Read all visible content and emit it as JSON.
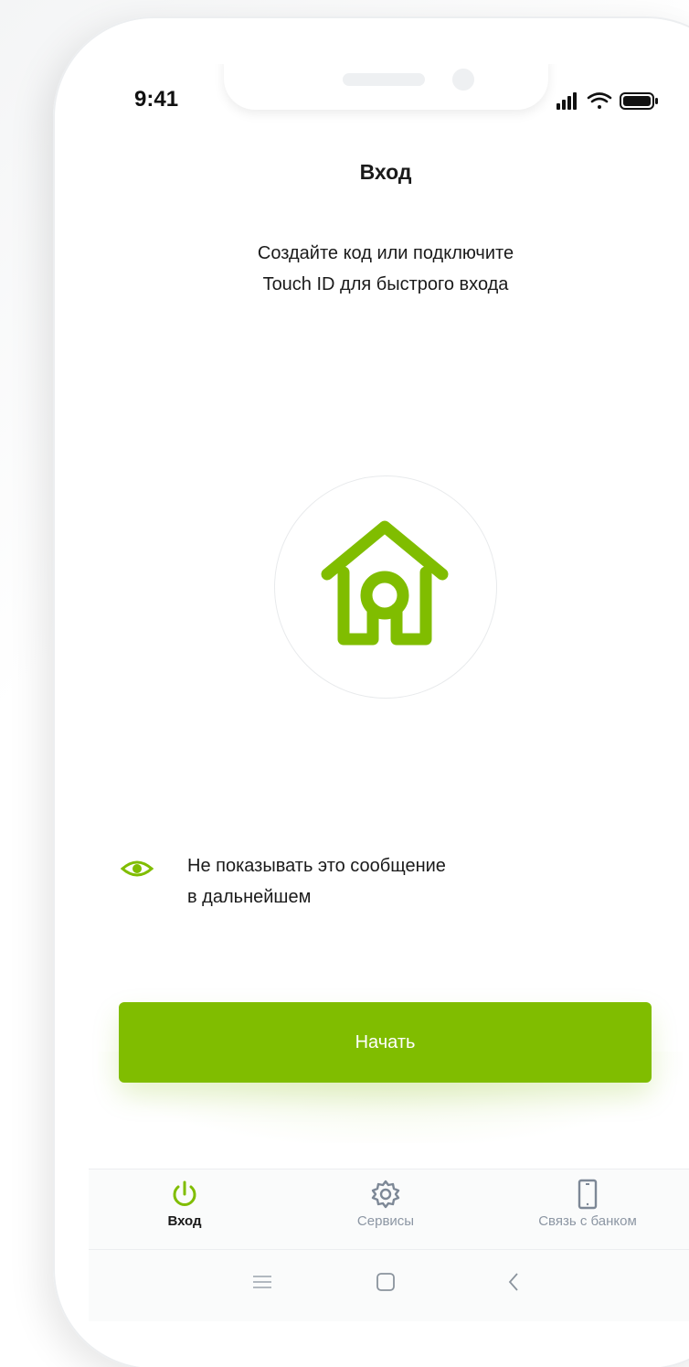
{
  "status_bar": {
    "time": "9:41",
    "icons": [
      "signal-icon",
      "wifi-icon",
      "battery-icon"
    ]
  },
  "header": {
    "title": "Вход"
  },
  "intro": {
    "line1": "Создайте код или подключите",
    "line2": "Touch ID для быстрого входа"
  },
  "logo": {
    "icon": "house-key-logo-icon",
    "color": "#80bd00"
  },
  "option": {
    "icon": "eye-icon",
    "line1": "Не показывать это сообщение",
    "line2": "в дальнейшем"
  },
  "primary_button": {
    "label": "Начать",
    "color": "#80bd00"
  },
  "tabbar": {
    "items": [
      {
        "label": "Вход",
        "icon": "power-icon",
        "active": true
      },
      {
        "label": "Сервисы",
        "icon": "gear-icon",
        "active": false
      },
      {
        "label": "Связь с банком",
        "icon": "phone-icon",
        "active": false
      }
    ]
  },
  "system_nav": {
    "icons": [
      "menu-icon",
      "home-square-icon",
      "back-chevron-icon"
    ]
  },
  "colors": {
    "accent": "#80bd00",
    "text": "#1a1a1a",
    "muted": "#8c96a3"
  }
}
